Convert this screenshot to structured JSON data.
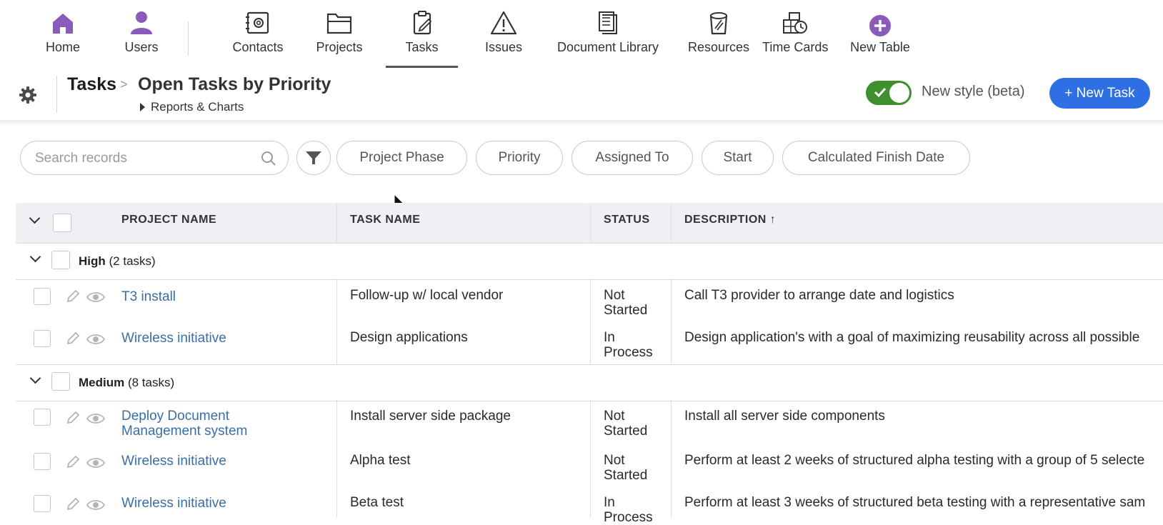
{
  "nav": {
    "items": [
      {
        "label": "Home",
        "icon": "home-icon"
      },
      {
        "label": "Users",
        "icon": "user-icon"
      },
      {
        "label": "Contacts",
        "icon": "contacts-icon"
      },
      {
        "label": "Projects",
        "icon": "folder-icon"
      },
      {
        "label": "Tasks",
        "icon": "clipboard-icon",
        "active": true
      },
      {
        "label": "Issues",
        "icon": "warning-icon"
      },
      {
        "label": "Document Library",
        "icon": "document-icon"
      },
      {
        "label": "Resources",
        "icon": "resources-icon"
      },
      {
        "label": "Time Cards",
        "icon": "time-cards-icon"
      },
      {
        "label": "New Table",
        "icon": "plus-circle-icon"
      }
    ]
  },
  "header": {
    "breadcrumb_root": "Tasks",
    "breadcrumb_sep": ">",
    "title": "Open Tasks by Priority",
    "reports_label": "Reports & Charts",
    "toggle_label": "New style (beta)",
    "toggle_on": true,
    "new_button": "+ New Task"
  },
  "filters": {
    "search_placeholder": "Search records",
    "chips": [
      "Project Phase",
      "Priority",
      "Assigned To",
      "Start",
      "Calculated Finish Date"
    ]
  },
  "table": {
    "columns": [
      "PROJECT NAME",
      "TASK NAME",
      "STATUS",
      "DESCRIPTION ↑"
    ],
    "groups": [
      {
        "name": "High",
        "count": "(2 tasks)",
        "rows": [
          {
            "project": "T3 install",
            "task": "Follow-up w/ local vendor",
            "status": "Not Started",
            "description": "Call T3 provider to arrange date and logistics"
          },
          {
            "project": "Wireless initiative",
            "task": "Design applications",
            "status": "In Process",
            "description": "Design application's with a goal of maximizing reusability across all possible"
          }
        ]
      },
      {
        "name": "Medium",
        "count": "(8 tasks)",
        "rows": [
          {
            "project": "Deploy Document Management system",
            "task": "Install server side package",
            "status": "Not Started",
            "description": "Install all server side components"
          },
          {
            "project": "Wireless initiative",
            "task": "Alpha test",
            "status": "Not Started",
            "description": "Perform at least 2 weeks of structured alpha testing with a group of 5 selecte"
          },
          {
            "project": "Wireless initiative",
            "task": "Beta test",
            "status": "In Process",
            "description": "Perform at least 3 weeks of structured beta testing with a representative sam"
          }
        ]
      }
    ]
  },
  "colors": {
    "accent": "#2f6fe4",
    "toggle_on": "#3f8f2e",
    "link": "#3b6ea5",
    "nav_icon_purple": "#8a5bb8"
  }
}
